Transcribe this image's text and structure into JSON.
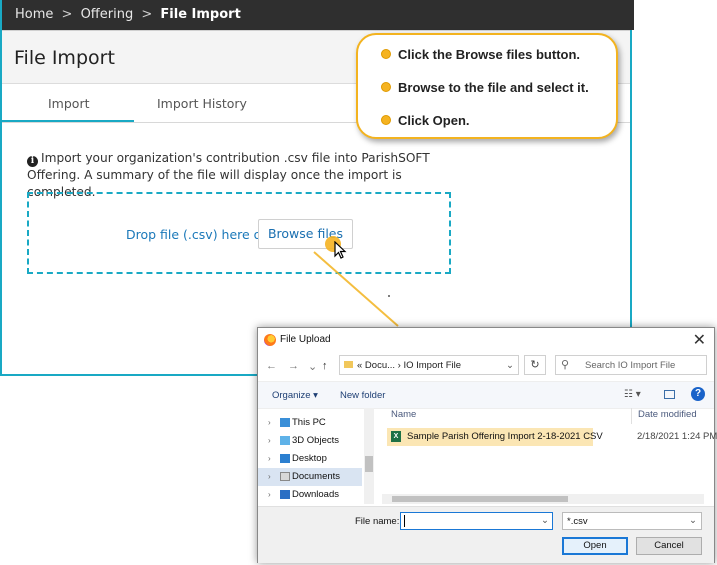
{
  "breadcrumb": {
    "home": "Home",
    "offering": "Offering",
    "current": "File Import",
    "separator": ">"
  },
  "page": {
    "title": "File Import"
  },
  "tabs": [
    {
      "label": "Import"
    },
    {
      "label": "Import History"
    }
  ],
  "info": {
    "text": "Import your organization's contribution .csv file into ParishSOFT Offering. A summary of the file will display once the import is completed."
  },
  "dropzone": {
    "text": "Drop file (.csv) here or",
    "browse_label": "Browse files"
  },
  "callout": {
    "steps": [
      "Click the Browse files button.",
      "Browse to the file and select it.",
      "Click Open."
    ]
  },
  "dialog": {
    "title": "File Upload",
    "path": "« Docu... › IO Import File",
    "search_placeholder": "Search IO Import File",
    "organize": "Organize ▾",
    "new_folder": "New folder",
    "nav_items": [
      "This PC",
      "3D Objects",
      "Desktop",
      "Documents",
      "Downloads"
    ],
    "columns": {
      "name": "Name",
      "date": "Date modified"
    },
    "file": {
      "name": "Sample Parish Offering Import 2-18-2021 CSV",
      "date": "2/18/2021 1:24 PM"
    },
    "file_name_label": "File name:",
    "filter": "*.csv",
    "open_label": "Open",
    "cancel_label": "Cancel"
  },
  "colors": {
    "accent": "#19a9c4",
    "callout": "#f3b31f",
    "link": "#1a78b9"
  }
}
